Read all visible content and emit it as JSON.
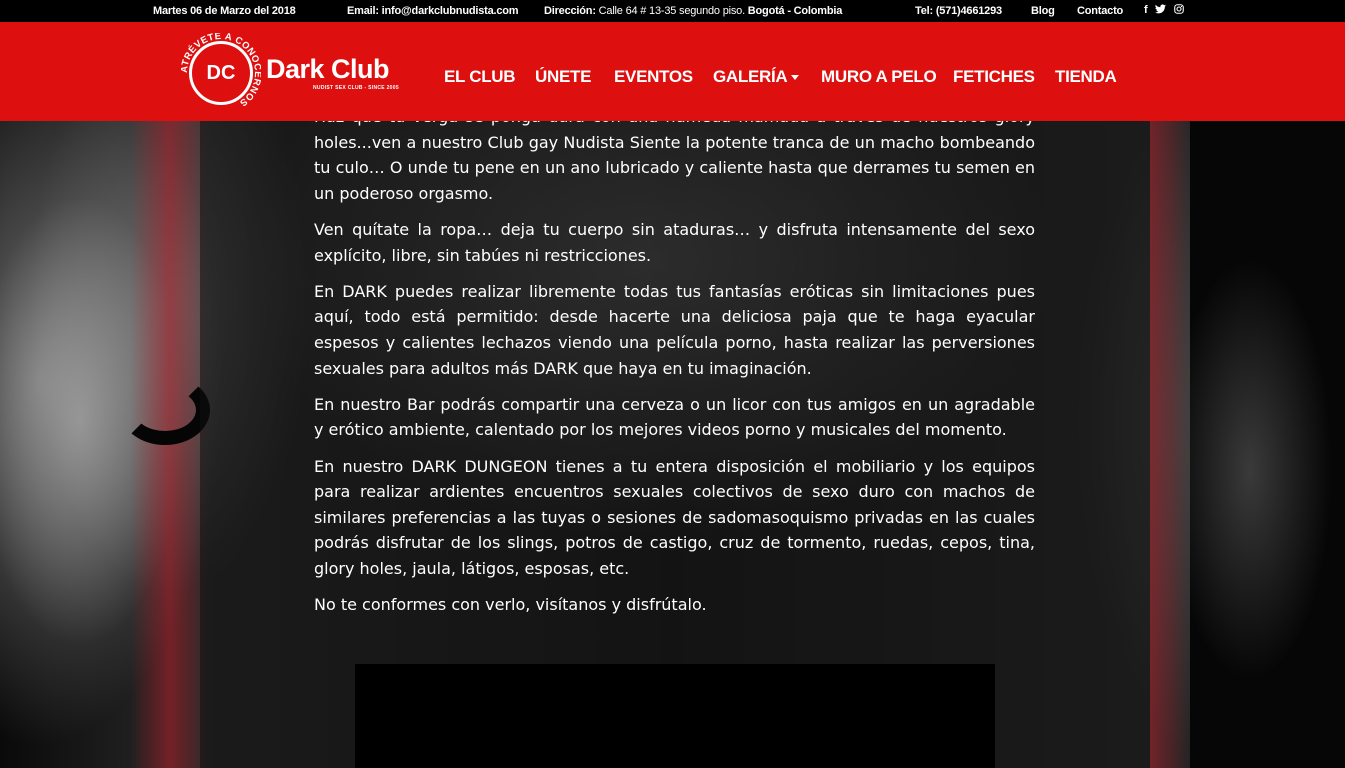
{
  "topbar": {
    "date": "Martes 06 de Marzo del 2018",
    "email_label": "Email:",
    "email_value": "info@darkclubnudista.com",
    "address_label": "Dirección:",
    "address_value": "Calle 64 # 13-35 segundo piso.",
    "city": "Bogotá - Colombia",
    "tel_label": "Tel:",
    "tel_value": "(571)4661293",
    "blog": "Blog",
    "contact": "Contacto",
    "social": [
      "facebook-icon",
      "twitter-icon",
      "instagram-icon"
    ]
  },
  "header": {
    "logo_initials": "DC",
    "logo_name": "Dark Club",
    "logo_sub": "NUDIST SEX CLUB - SINCE 2005",
    "logo_ring": "ATRÉVETE A CONOCERNOS",
    "nav": [
      "EL CLUB",
      "ÚNETE",
      "EVENTOS",
      "GALERÍA",
      "MURO A PELO",
      "FETICHES",
      "TIENDA"
    ],
    "colors": {
      "header_bg": "#dd0f0f",
      "topbar_bg": "#000000"
    }
  },
  "article": {
    "p0": "Haz que tu verga se ponga dura con una húmeda mamada a través de nuestros glory holes...ven a nuestro Club gay Nudista Siente la potente tranca de un macho bombeando tu culo… O unde tu pene en un ano lubricado y caliente hasta que derrames tu semen en un poderoso orgasmo.",
    "p1": "Ven quítate la ropa… deja tu cuerpo sin ataduras… y disfruta intensamente del sexo explícito, libre, sin tabúes ni restricciones.",
    "p2": "En DARK puedes realizar libremente todas tus fantasías eróticas sin limitaciones pues aquí, todo está permitido: desde hacerte una deliciosa paja que te haga eyacular espesos y calientes lechazos viendo una película porno, hasta realizar las perversiones sexuales para adultos más DARK que haya en tu imaginación.",
    "p3": "En nuestro Bar podrás compartir una cerveza o un licor con tus amigos en un agradable y erótico ambiente, calentado por los mejores videos porno y musicales del momento.",
    "p4": "En nuestro DARK DUNGEON tienes a tu entera disposición el mobiliario y los equipos para realizar ardientes encuentros sexuales colectivos de sexo duro con machos de similares preferencias a las tuyas o sesiones de sadomasoquismo privadas en las cuales podrás disfrutar de los slings, potros de castigo, cruz de tormento, ruedas, cepos, tina, glory holes, jaula, látigos, esposas, etc.",
    "p5": "No te conformes con verlo, visítanos y disfrútalo."
  }
}
